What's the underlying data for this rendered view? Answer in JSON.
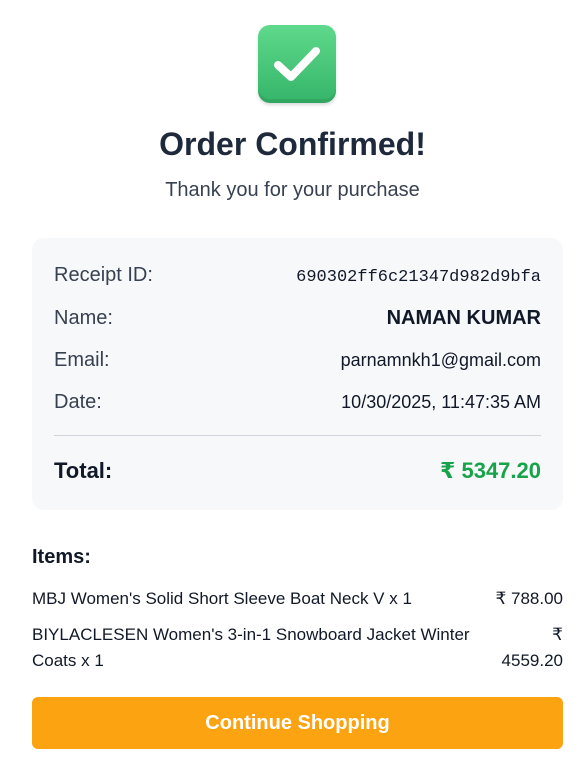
{
  "header": {
    "icon": "check-mark-icon",
    "title": "Order Confirmed!",
    "subtitle": "Thank you for your purchase"
  },
  "receipt": {
    "receipt_id_label": "Receipt ID:",
    "receipt_id": "690302ff6c21347d982d9bfa",
    "name_label": "Name:",
    "name": "NAMAN KUMAR",
    "email_label": "Email:",
    "email": "parnamnkh1@gmail.com",
    "date_label": "Date:",
    "date": "10/30/2025, 11:47:35 AM",
    "total_label": "Total:",
    "total": "₹ 5347.20"
  },
  "items": {
    "title": "Items:",
    "list": [
      {
        "name": "MBJ Women's Solid Short Sleeve Boat Neck V x 1",
        "price": "₹ 788.00"
      },
      {
        "name": "BIYLACLESEN Women's 3-in-1 Snowboard Jacket Winter Coats x 1",
        "price": "₹ 4559.20"
      }
    ]
  },
  "actions": {
    "continue_label": "Continue Shopping"
  },
  "colors": {
    "accent_button": "#fca311",
    "success_green": "#16a34a",
    "check_green": "#35b56a"
  }
}
